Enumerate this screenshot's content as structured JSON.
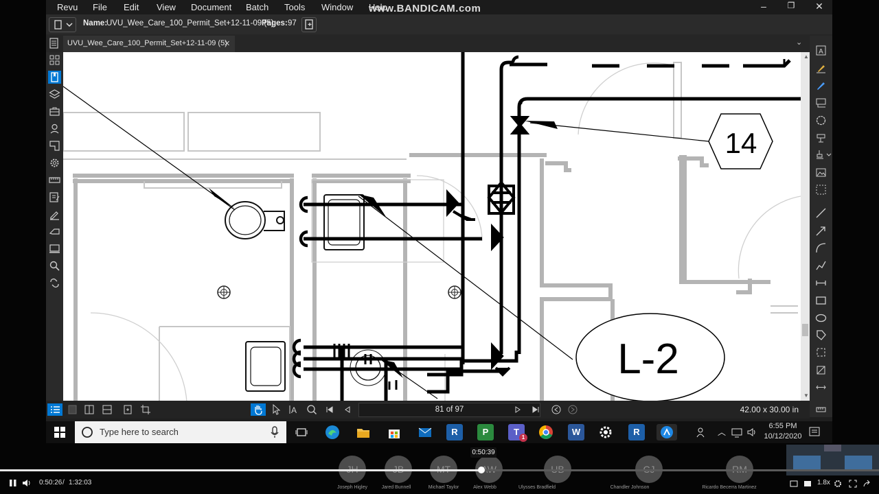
{
  "menu": [
    "Revu",
    "File",
    "Edit",
    "View",
    "Document",
    "Batch",
    "Tools",
    "Window",
    "Help"
  ],
  "watermark": "www.BANDICAM.com",
  "window_controls": {
    "minimize": "–",
    "restore": "❐",
    "close": "✕"
  },
  "docbar": {
    "name_label": "Name:",
    "name_value": "UVU_Wee_Care_100_Permit_Set+12-11-09 (5)",
    "pages_label": "Pages:",
    "pages_value": "97"
  },
  "tab": {
    "label": "UVU_Wee_Care_100_Permit_Set+12-11-09 (5)",
    "close": "✕"
  },
  "drawing": {
    "tag_14": "14",
    "tag_L2": "L-2"
  },
  "navigation": {
    "page_display": "81 of 97",
    "dimensions": "42.00 x 30.00 in"
  },
  "taskbar": {
    "search_placeholder": "Type here to search",
    "time": "6:55 PM",
    "date": "10/12/2020",
    "badge_count": "1"
  },
  "video": {
    "current_time": "0:50:26",
    "separator": "/",
    "total_time": "1:32:03",
    "hover_time": "0:50:39",
    "speed": "1.8x",
    "progress_fraction": 0.548,
    "participants": [
      {
        "initials": "JH",
        "name": "Joseph Higley"
      },
      {
        "initials": "JB",
        "name": "Jared Bunnell"
      },
      {
        "initials": "MT",
        "name": "Michael Taylor"
      },
      {
        "initials": "AW",
        "name": "Alex Webb"
      },
      {
        "initials": "UB",
        "name": "Ulysses Bradfield"
      },
      {
        "initials": "CJ",
        "name": "Chandler Johnson"
      },
      {
        "initials": "RM",
        "name": "Ricardo Becerra Martinez"
      }
    ]
  },
  "colors": {
    "accent": "#0078d4",
    "dark": "#1f1f1f",
    "pipe": "#000000",
    "wall": "#b4b4b4"
  }
}
